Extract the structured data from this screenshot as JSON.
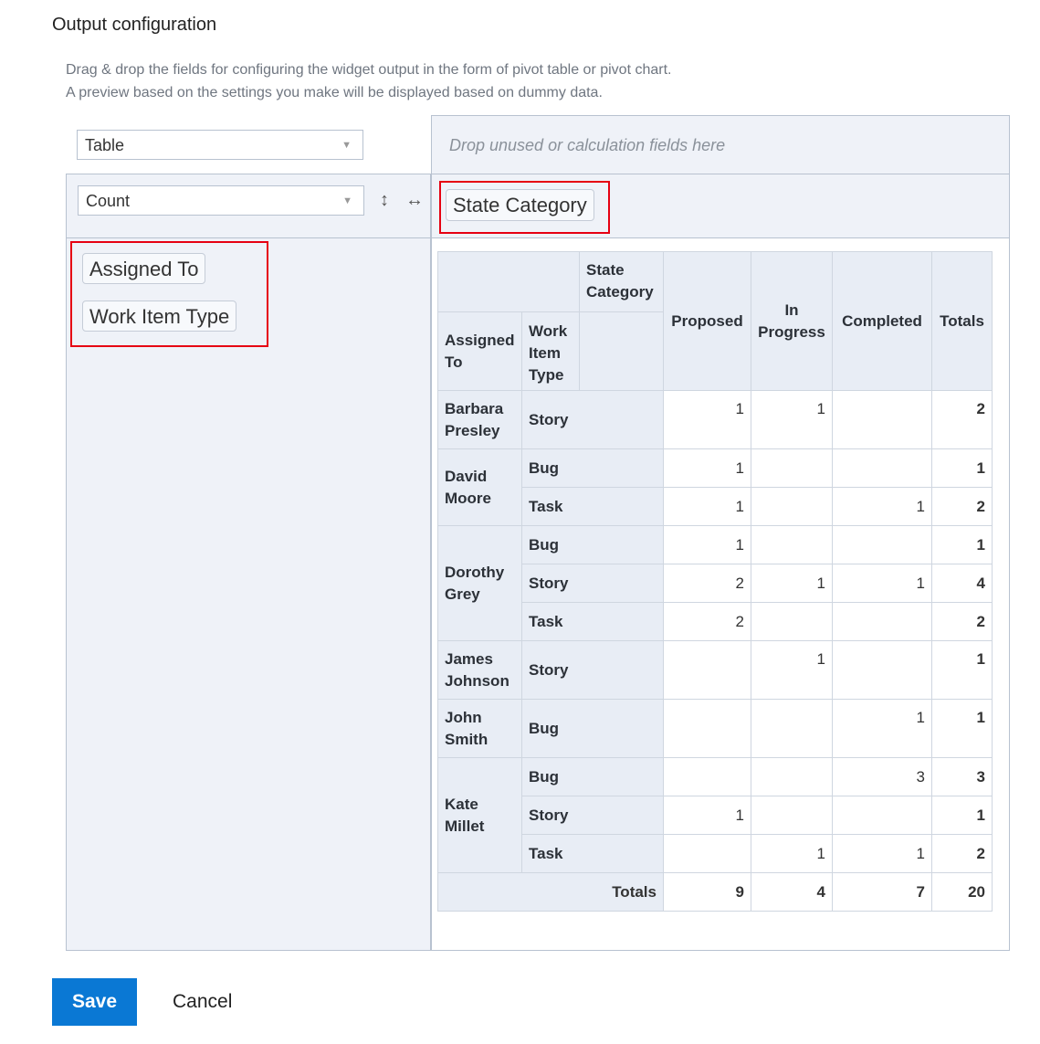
{
  "heading": "Output configuration",
  "description": {
    "line1": "Drag & drop the fields for configuring the widget output in the form of pivot table or pivot chart.",
    "line2": "A preview based on the settings you make will be displayed based on dummy data."
  },
  "view_select": {
    "value": "Table"
  },
  "aggregation_select": {
    "value": "Count"
  },
  "icons": {
    "vertical": "vertical-arrows-icon",
    "horizontal": "horizontal-arrows-icon"
  },
  "dropzone": {
    "placeholder": "Drop unused or calculation fields here"
  },
  "column_fields": [
    "State Category"
  ],
  "row_fields": [
    "Assigned To",
    "Work Item Type"
  ],
  "pivot": {
    "state_category_header": "State Category",
    "assigned_to_header": "Assigned To",
    "work_item_type_header": "Work Item Type",
    "columns": [
      "Proposed",
      "In Progress",
      "Completed",
      "Totals"
    ],
    "groups": [
      {
        "name": "Barbara Presley",
        "rows": [
          {
            "type": "Story",
            "values": [
              "1",
              "1",
              "",
              "2"
            ]
          }
        ]
      },
      {
        "name": "David Moore",
        "rows": [
          {
            "type": "Bug",
            "values": [
              "1",
              "",
              "",
              "1"
            ]
          },
          {
            "type": "Task",
            "values": [
              "1",
              "",
              "1",
              "2"
            ]
          }
        ]
      },
      {
        "name": "Dorothy Grey",
        "rows": [
          {
            "type": "Bug",
            "values": [
              "1",
              "",
              "",
              "1"
            ]
          },
          {
            "type": "Story",
            "values": [
              "2",
              "1",
              "1",
              "4"
            ]
          },
          {
            "type": "Task",
            "values": [
              "2",
              "",
              "",
              "2"
            ]
          }
        ]
      },
      {
        "name": "James Johnson",
        "rows": [
          {
            "type": "Story",
            "values": [
              "",
              "1",
              "",
              "1"
            ]
          }
        ]
      },
      {
        "name": "John Smith",
        "rows": [
          {
            "type": "Bug",
            "values": [
              "",
              "",
              "1",
              "1"
            ]
          }
        ]
      },
      {
        "name": "Kate Millet",
        "rows": [
          {
            "type": "Bug",
            "values": [
              "",
              "",
              "3",
              "3"
            ]
          },
          {
            "type": "Story",
            "values": [
              "1",
              "",
              "",
              "1"
            ]
          },
          {
            "type": "Task",
            "values": [
              "",
              "1",
              "1",
              "2"
            ]
          }
        ]
      }
    ],
    "totals_label": "Totals",
    "totals": [
      "9",
      "4",
      "7",
      "20"
    ]
  },
  "buttons": {
    "save": "Save",
    "cancel": "Cancel"
  },
  "colors": {
    "accent": "#0a78d4",
    "highlight": "#e60012",
    "header_bg": "#e8edf5"
  }
}
